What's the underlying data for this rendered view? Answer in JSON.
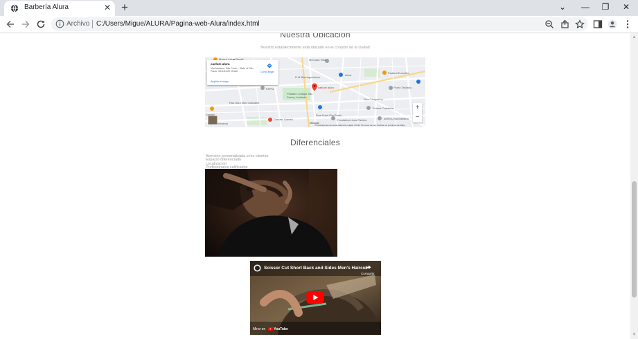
{
  "browser": {
    "tab_title": "Barbería Alura",
    "tab_close": "✕",
    "new_tab": "+",
    "scheme_label": "Archivo",
    "url": "C:/Users/Migue/ALURA/Pagina-web-Alura/index.html",
    "window_controls": {
      "minimize": "—",
      "restore": "❐",
      "close": "✕",
      "tab_list": "⌄"
    }
  },
  "page": {
    "location_title": "Nuestra Ubicación",
    "location_subtitle": "Nuestro establecimiento está ubicado en el corazón de la ciudad",
    "map": {
      "place_name": "caelum alura",
      "address": "Vila Mariana, São Paulo - State of São Paulo, 04118-020, Brazil",
      "directions_label": "Cómo llegar",
      "enlarge_label": "Ampliar el mapa",
      "pin_label": "caelum alura",
      "labels": {
        "l1": "Museu Lasar Segall",
        "l2": "Mercado Villa",
        "l3": "Alura",
        "l4": "R M Biomagnetismo",
        "l5": "Padaria Eurosifla",
        "l6": "Pulsário Colégio São Paulo | Unidade...",
        "l7": "Estrela Cafeteria",
        "l8": "ESPM",
        "l9": "Domain Games",
        "l10": "Fondation Licas Pavlieu",
        "l11": "IMREA Vila Mariana",
        "l12": "Sawaki",
        "l13": "Desenvolvimento",
        "l14": "Ponto Teilando",
        "l15": "Rua Saul Mou Ganzalez",
        "l16": "Rua Dutra Pra Prado",
        "l17": "Rua Canquinho",
        "l18": "Google"
      },
      "attribution": "Combinaciones de teclas   Datos de mapas ©2022   Términos de uso   Notificar un problema de Maps",
      "zoom_in": "+",
      "zoom_out": "−"
    },
    "diferenciales_title": "Diferenciales",
    "diferenciales": [
      "Atención personalizada a los clientes",
      "Espacio diferenciado",
      "Localización",
      "Profesionales calificados"
    ],
    "video": {
      "title": "Scissor Cut Short Back and Sides Men's Haircut",
      "share_label": "Compartir",
      "watch_on": "Mirar en",
      "platform": "YouTube"
    }
  }
}
